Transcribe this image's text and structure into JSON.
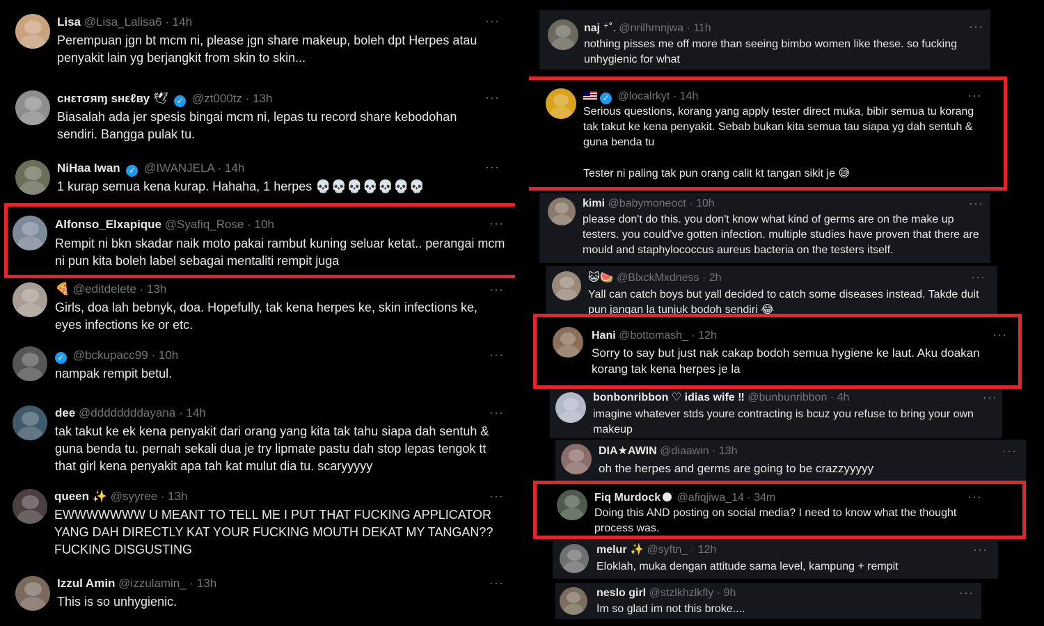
{
  "left": [
    {
      "name": "Lisa",
      "name_suffix": "",
      "handle": "@Lisa_Lalisa6",
      "time": "14h",
      "body": "Perempuan jgn bt mcm ni, please jgn share makeup, boleh dpt Herpes atau penyakit lain yg berjangkit from skin to skin..."
    },
    {
      "name": "cнεтσяɱ ѕнεℓву",
      "name_suffix": "🕊",
      "handle": "@zt000tz",
      "time": "13h",
      "body": "Biasalah ada jer spesis bingai mcm ni, lepas tu record share kebodohan sendiri. Bangga pulak tu."
    },
    {
      "name": "NiHaa Iwan",
      "name_suffix": "",
      "handle": "@IWANJELA",
      "time": "14h",
      "body": "1 kurap semua kena kurap. Hahaha, 1 herpes 💀💀💀💀💀💀💀"
    },
    {
      "name": "Alfonso_Elxapique",
      "name_suffix": "",
      "handle": "@Syafiq_Rose",
      "time": "10h",
      "body": "Rempit ni bkn skadar naik moto pakai rambut kuning seluar ketat.. perangai mcm ni pun kita boleh label sebagai mentaliti rempit juga"
    },
    {
      "name": "",
      "name_suffix": "🍕",
      "handle": "@editdelete",
      "time": "13h",
      "body": "Girls, doa lah bebnyk, doa. Hopefully, tak kena herpes ke, skin infections ke, eyes infections ke or etc."
    },
    {
      "name": "",
      "name_suffix": "",
      "handle": "@bckupacc99",
      "time": "10h",
      "body": "nampak rempit betul."
    },
    {
      "name": "dee",
      "name_suffix": "",
      "handle": "@ddddddddayana",
      "time": "14h",
      "body": "tak takut ke ek kena penyakit dari orang yang kita tak tahu siapa dah sentuh & guna benda tu. pernah sekali dua je try lipmate pastu dah stop lepas tengok tt that girl kena penyakit apa tah kat mulut dia tu. scaryyyyy"
    },
    {
      "name": "queen",
      "name_suffix": "✨",
      "handle": "@syyree",
      "time": "13h",
      "body": "EWWWWWWW U MEANT TO TELL ME I PUT THAT FUCKING APPLICATOR YANG DAH DIRECTLY KAT YOUR FUCKING MOUTH DEKAT MY TANGAN?? FUCKING DISGUSTING"
    },
    {
      "name": "Izzul Amin",
      "name_suffix": "",
      "handle": "@izzulamin_",
      "time": "13h",
      "body": "This is so unhygienic."
    }
  ],
  "right": [
    {
      "name": "naj",
      "name_suffix": "⁺˚.",
      "handle": "@nrilhmnjwa",
      "time": "11h",
      "body": "nothing pisses me off more than seeing bimbo women like these. so fucking unhygienic for what"
    },
    {
      "name": "",
      "name_suffix": "",
      "handle": "@localrkyt",
      "time": "14h",
      "body": "Serious questions, korang yang apply tester direct muka, bibir semua tu korang tak takut ke kena penyakit. Sebab bukan kita semua tau siapa yg dah sentuh & guna benda tu",
      "body2": "Tester ni paling tak pun orang calit kt tangan sikit je 😅"
    },
    {
      "name": "kimi",
      "name_suffix": "",
      "handle": "@babymoneoct",
      "time": "10h",
      "body": "please don't do this. you don't know what kind of germs are on the make up testers. you could've gotten infection. multiple studies have proven that there are mould and staphylococcus aureus bacteria on the testers itself."
    },
    {
      "name": "",
      "name_suffix": "😺🍉",
      "handle": "@BlxckMxdness",
      "time": "2h",
      "body": "Yall can catch boys but yall decided to catch some diseases instead. Takde duit pun jangan la tunjuk bodoh sendiri 😂"
    },
    {
      "name": "Hani",
      "name_suffix": "",
      "handle": "@bottomash_",
      "time": "12h",
      "body": "Sorry to say but just nak cakap bodoh semua hygiene ke laut. Aku doakan korang tak kena herpes je la"
    },
    {
      "name": "bonbonribbon ♡ idias wife ‼",
      "name_suffix": "",
      "handle": "@bunbunribbon",
      "time": "4h",
      "body": "imagine whatever stds youre contracting is bcuz you refuse to bring your own makeup"
    },
    {
      "name": "DIA★AWIN",
      "name_suffix": "",
      "handle": "@diaawin",
      "time": "13h",
      "body": "oh the herpes and germs are going to be crazzyyyyy"
    },
    {
      "name": "Fiq Murdock",
      "name_suffix": "",
      "handle": "@afiqjiwa_14",
      "time": "34m",
      "body": "Doing this AND posting on social media? I need to know what the thought process was."
    },
    {
      "name": "melur",
      "name_suffix": "✨",
      "handle": "@syftn_",
      "time": "12h",
      "body": "Eloklah, muka dengan attitude sama level, kampung + rempit"
    },
    {
      "name": "neslo girl",
      "name_suffix": "",
      "handle": "@stzlkhzlkfly",
      "time": "9h",
      "body": "Im so glad im not this broke...."
    }
  ],
  "more_label": "···",
  "sep": " · ",
  "colors": {
    "highlight": "#e8242b",
    "verified": "#1d9bf0",
    "handle": "#71767b",
    "text": "#e7e9ea"
  }
}
